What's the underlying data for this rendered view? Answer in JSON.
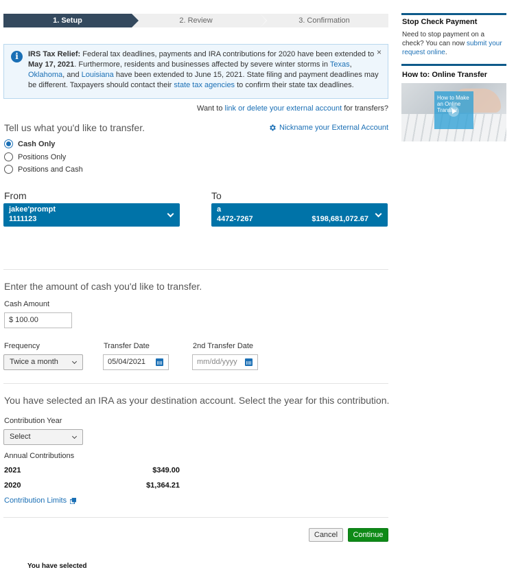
{
  "stepper": {
    "steps": [
      "1. Setup",
      "2. Review",
      "3. Confirmation"
    ],
    "active_index": 0
  },
  "alert": {
    "title": "IRS Tax Relief:",
    "text1": " Federal tax deadlines, payments and IRA contributions for 2020 have been extended to ",
    "date": "May 17, 2021",
    "text2": ". Furthermore, residents and businesses affected by severe winter storms in ",
    "link_texas": "Texas",
    "sep1": ", ",
    "link_oklahoma": "Oklahoma",
    "sep2": ", and ",
    "link_louisiana": "Louisiana",
    "text3": " have been extended to June 15, 2021. State filing and payment deadlines may be different. Taxpayers should contact their ",
    "link_state": "state tax agencies",
    "text4": " to confirm their state tax deadlines.",
    "close_glyph": "×"
  },
  "external": {
    "prefix": "Want to ",
    "link": "link or delete your external account",
    "suffix": " for transfers?"
  },
  "transfer": {
    "heading": "Tell us what you'd like to transfer.",
    "nickname_link": "Nickname your External Account",
    "options": [
      "Cash Only",
      "Positions Only",
      "Positions and Cash"
    ],
    "selected": "Cash Only"
  },
  "from": {
    "label": "From",
    "name": "jakee'prompt",
    "number": "1111123"
  },
  "to": {
    "label": "To",
    "name": "a",
    "number": "4472-7267",
    "balance": "$198,681,072.67"
  },
  "cash": {
    "heading": "Enter the amount of cash you'd like to transfer.",
    "amount_label": "Cash Amount",
    "amount_value": "$ 100.00"
  },
  "schedule": {
    "frequency_label": "Frequency",
    "frequency_value": "Twice a month",
    "transfer_date_label": "Transfer Date",
    "transfer_date_value": "05/04/2021",
    "second_date_label": "2nd Transfer Date",
    "second_date_placeholder": "mm/dd/yyyy"
  },
  "ira": {
    "heading": "You have selected an IRA as your destination account. Select the year for this contribution.",
    "year_label": "Contribution Year",
    "year_value": "Select",
    "annual_label": "Annual Contributions",
    "rows": [
      {
        "year": "2021",
        "amount": "$349.00"
      },
      {
        "year": "2020",
        "amount": "$1,364.21"
      }
    ],
    "limits_link": "Contribution Limits"
  },
  "actions": {
    "cancel": "Cancel",
    "continue": "Continue"
  },
  "footer_text": "You have selected",
  "sidebar": {
    "stop_title": "Stop Check Payment",
    "stop_text": "Need to stop payment on a check? You can now ",
    "stop_link": "submit your request online",
    "stop_end": ".",
    "howto_title": "How to: Online Transfer",
    "video_caption": "How to Make an Online Transfer"
  }
}
